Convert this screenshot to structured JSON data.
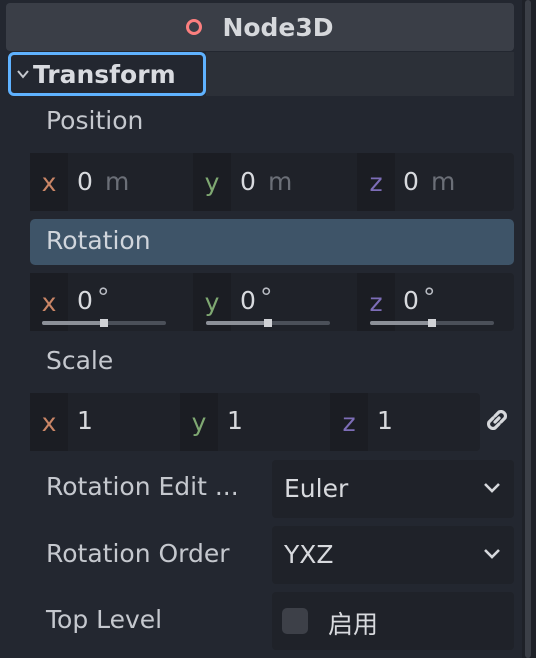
{
  "header": {
    "title": "Node3D",
    "icon": "node3d-circle-icon",
    "icon_color": "#fc7f7f"
  },
  "section": {
    "title": "Transform",
    "expanded": true,
    "focus_color": "#5fb2ff"
  },
  "position": {
    "label": "Position",
    "x": {
      "axis": "x",
      "value": "0",
      "unit": "m"
    },
    "y": {
      "axis": "y",
      "value": "0",
      "unit": "m"
    },
    "z": {
      "axis": "z",
      "value": "0",
      "unit": "m"
    }
  },
  "rotation": {
    "label": "Rotation",
    "highlight_color": "#3e5468",
    "x": {
      "axis": "x",
      "value": "0",
      "unit": "°",
      "slider": 0.5
    },
    "y": {
      "axis": "y",
      "value": "0",
      "unit": "°",
      "slider": 0.5
    },
    "z": {
      "axis": "z",
      "value": "0",
      "unit": "°",
      "slider": 0.5
    }
  },
  "scale": {
    "label": "Scale",
    "x": {
      "axis": "x",
      "value": "1"
    },
    "y": {
      "axis": "y",
      "value": "1"
    },
    "z": {
      "axis": "z",
      "value": "1"
    },
    "link_icon": "chain-link-icon"
  },
  "rotation_edit_mode": {
    "label": "Rotation Edit ...",
    "value": "Euler"
  },
  "rotation_order": {
    "label": "Rotation Order",
    "value": "YXZ"
  },
  "top_level": {
    "label": "Top Level",
    "checkbox_label": "启用",
    "checked": false
  },
  "colors": {
    "axis_x": "#c98566",
    "axis_y": "#7fa872",
    "axis_z": "#7d6db7"
  }
}
